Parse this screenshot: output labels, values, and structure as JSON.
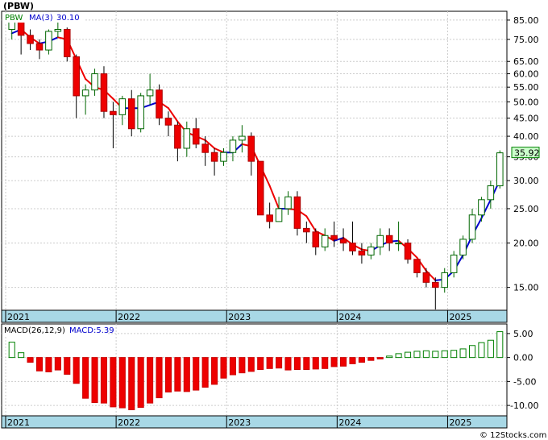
{
  "title": "(PBW)",
  "watermark": "© 12Stocks.com",
  "chart_data": [
    {
      "type": "candlestick",
      "yscale": "log",
      "ylim": [
        13,
        90
      ],
      "legend": {
        "ticker": "PBW",
        "ma_label": "MA(3)",
        "ma_value": "30.10"
      },
      "last_price_label": "35.92",
      "yticks": [
        {
          "v": 85,
          "label": "85.00"
        },
        {
          "v": 75,
          "label": "75.00"
        },
        {
          "v": 65,
          "label": "65.00"
        },
        {
          "v": 60,
          "label": "60.00"
        },
        {
          "v": 55,
          "label": "55.00"
        },
        {
          "v": 50,
          "label": "50.00"
        },
        {
          "v": 45,
          "label": "45.00"
        },
        {
          "v": 40,
          "label": "40.00"
        },
        {
          "v": 35,
          "label": "35.00"
        },
        {
          "v": 30,
          "label": "30.00"
        },
        {
          "v": 25,
          "label": "25.00"
        },
        {
          "v": 20,
          "label": "20.00"
        },
        {
          "v": 15,
          "label": "15.00"
        }
      ],
      "xlabels": [
        {
          "i": 0,
          "label": "2021"
        },
        {
          "i": 12,
          "label": "2022"
        },
        {
          "i": 24,
          "label": "2023"
        },
        {
          "i": 36,
          "label": "2024"
        },
        {
          "i": 48,
          "label": "2025"
        }
      ],
      "candles": [
        [
          80,
          86,
          75,
          84
        ],
        [
          84,
          85,
          68,
          77
        ],
        [
          77,
          80,
          70,
          73
        ],
        [
          73,
          75,
          66,
          70
        ],
        [
          70,
          80,
          68,
          79
        ],
        [
          79,
          88,
          76,
          80
        ],
        [
          80,
          81,
          65,
          67
        ],
        [
          67,
          68,
          45,
          52
        ],
        [
          52,
          56,
          46,
          54
        ],
        [
          54,
          62,
          52,
          60
        ],
        [
          60,
          63,
          45,
          47
        ],
        [
          47,
          50,
          37,
          46
        ],
        [
          46,
          52,
          43,
          51
        ],
        [
          51,
          54,
          40,
          42
        ],
        [
          42,
          53,
          41,
          52
        ],
        [
          52,
          60,
          49,
          54
        ],
        [
          54,
          56,
          43,
          45
        ],
        [
          45,
          47,
          40,
          43
        ],
        [
          43,
          44,
          34,
          37
        ],
        [
          37,
          44,
          35,
          42
        ],
        [
          42,
          45,
          37,
          38
        ],
        [
          38,
          40,
          33,
          36
        ],
        [
          36,
          37,
          31,
          34
        ],
        [
          34,
          37,
          33,
          36
        ],
        [
          36,
          40,
          34,
          39
        ],
        [
          39,
          43,
          36,
          40
        ],
        [
          40,
          41,
          31,
          34
        ],
        [
          34,
          34,
          24,
          24
        ],
        [
          24,
          26,
          22,
          23
        ],
        [
          23,
          27,
          23,
          25
        ],
        [
          25,
          28,
          24,
          27
        ],
        [
          27,
          28,
          21,
          22
        ],
        [
          22,
          23,
          20,
          21.5
        ],
        [
          21.5,
          22,
          18.5,
          19.5
        ],
        [
          19.5,
          22,
          19,
          21
        ],
        [
          21,
          23,
          19.5,
          20.5
        ],
        [
          20.5,
          22,
          19,
          20
        ],
        [
          20,
          23,
          18.5,
          19
        ],
        [
          19,
          20,
          17.5,
          18.5
        ],
        [
          18.5,
          20,
          18,
          19.5
        ],
        [
          19.5,
          22,
          18.5,
          21
        ],
        [
          21,
          22,
          19,
          20
        ],
        [
          20,
          23,
          19,
          20
        ],
        [
          20,
          20.5,
          17.5,
          18
        ],
        [
          18,
          18,
          16,
          16.5
        ],
        [
          16.5,
          17,
          15,
          15.5
        ],
        [
          15.5,
          16,
          13,
          15
        ],
        [
          15,
          17,
          14.5,
          16.5
        ],
        [
          16.5,
          19,
          16,
          18.5
        ],
        [
          18.5,
          21,
          18,
          20.5
        ],
        [
          20.5,
          25,
          20,
          24
        ],
        [
          24,
          27,
          23,
          26.5
        ],
        [
          26.5,
          30,
          25,
          29
        ],
        [
          29,
          36.5,
          28.5,
          35.92
        ]
      ],
      "ma": [
        78,
        80,
        76,
        73,
        74,
        76,
        75,
        66,
        58,
        55,
        54,
        51,
        48,
        48,
        48,
        49,
        50,
        48,
        44,
        41,
        40,
        39,
        37,
        36,
        36,
        38,
        37.5,
        33,
        29,
        25,
        25,
        24.8,
        23.8,
        21.6,
        21,
        20.3,
        20.7,
        19.8,
        19.2,
        19,
        19.7,
        20.2,
        20.3,
        19.3,
        18.2,
        16.7,
        15.7,
        15.8,
        16.7,
        18.5,
        21,
        23.5,
        26.5,
        30.1
      ]
    },
    {
      "type": "bar",
      "name": "macd",
      "ylim": [
        -12,
        7
      ],
      "legend": {
        "label": "MACD(26,12,9)",
        "value_label": "MACD:5.39"
      },
      "yticks": [
        {
          "v": 5,
          "label": "5.00"
        },
        {
          "v": 0,
          "label": "0.00"
        },
        {
          "v": -5,
          "label": "-5.00"
        },
        {
          "v": -10,
          "label": "-10.00"
        }
      ],
      "xlabels": [
        {
          "i": 0,
          "label": "2021"
        },
        {
          "i": 12,
          "label": "2022"
        },
        {
          "i": 24,
          "label": "2023"
        },
        {
          "i": 36,
          "label": "2024"
        },
        {
          "i": 48,
          "label": "2025"
        }
      ],
      "values": [
        3.2,
        1.0,
        -1.0,
        -2.8,
        -3.0,
        -2.6,
        -3.5,
        -5.4,
        -8.5,
        -9.4,
        -9.5,
        -10.3,
        -10.5,
        -10.9,
        -10.4,
        -9.5,
        -8.4,
        -7.2,
        -7.0,
        -7.1,
        -6.8,
        -6.2,
        -5.6,
        -4.3,
        -3.6,
        -3.2,
        -2.9,
        -2.5,
        -2.3,
        -2.2,
        -2.6,
        -2.5,
        -2.5,
        -2.4,
        -2.3,
        -1.9,
        -1.8,
        -1.3,
        -1.0,
        -0.6,
        -0.3,
        0.3,
        0.8,
        1.1,
        1.3,
        1.4,
        1.3,
        1.4,
        1.5,
        1.8,
        2.5,
        3.1,
        3.6,
        5.39
      ]
    }
  ]
}
